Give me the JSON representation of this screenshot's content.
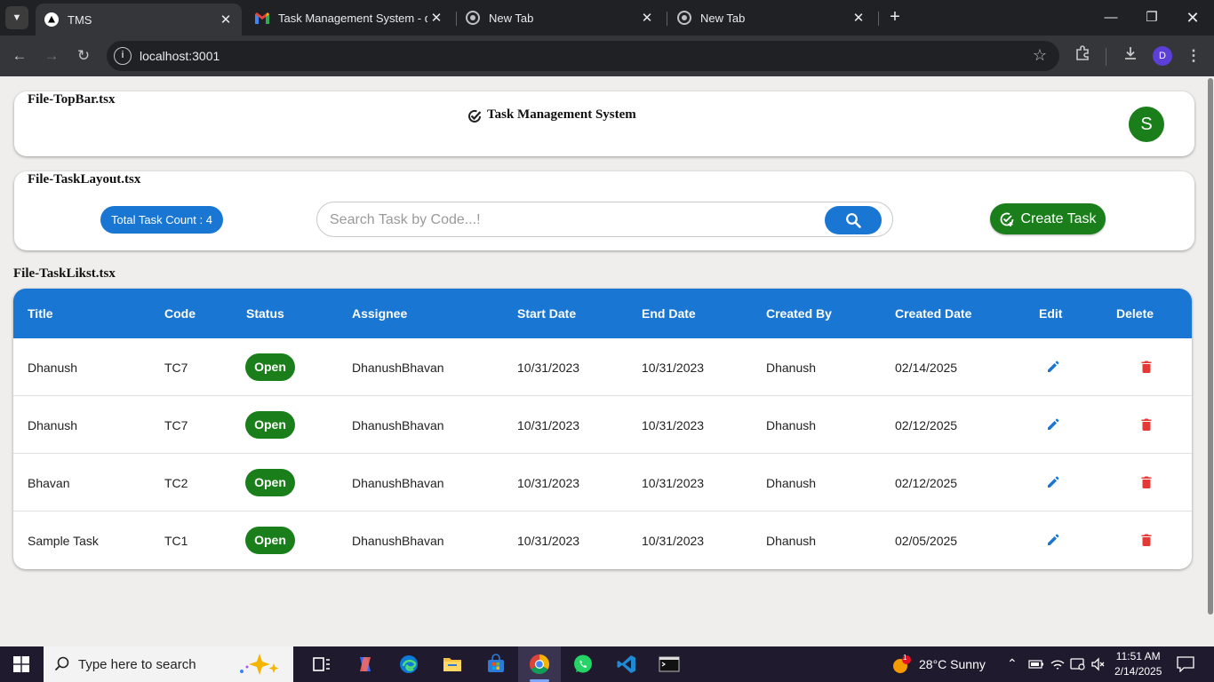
{
  "browser": {
    "tabs": [
      {
        "title": "TMS",
        "active": true
      },
      {
        "title": "Task Management System - dha",
        "active": false
      },
      {
        "title": "New Tab",
        "active": false
      },
      {
        "title": "New Tab",
        "active": false
      }
    ],
    "url": "localhost:3001",
    "profile_initial": "D"
  },
  "topbar": {
    "file_label": "File-TopBar.tsx",
    "title": "Task Management System",
    "avatar_initial": "S"
  },
  "task_layout": {
    "file_label": "File-TaskLayout.tsx",
    "count_label": "Total Task Count : 4",
    "search_placeholder": "Search Task by Code...!",
    "create_label": "Create Task"
  },
  "task_list": {
    "file_label": "File-TaskLikst.tsx",
    "columns": [
      "Title",
      "Code",
      "Status",
      "Assignee",
      "Start Date",
      "End Date",
      "Created By",
      "Created Date",
      "Edit",
      "Delete"
    ],
    "rows": [
      {
        "title": "Dhanush",
        "code": "TC7",
        "status": "Open",
        "assignee": "DhanushBhavan",
        "start": "10/31/2023",
        "end": "10/31/2023",
        "created_by": "Dhanush",
        "created_date": "02/14/2025"
      },
      {
        "title": "Dhanush",
        "code": "TC7",
        "status": "Open",
        "assignee": "DhanushBhavan",
        "start": "10/31/2023",
        "end": "10/31/2023",
        "created_by": "Dhanush",
        "created_date": "02/12/2025"
      },
      {
        "title": "Bhavan",
        "code": "TC2",
        "status": "Open",
        "assignee": "DhanushBhavan",
        "start": "10/31/2023",
        "end": "10/31/2023",
        "created_by": "Dhanush",
        "created_date": "02/12/2025"
      },
      {
        "title": "Sample Task",
        "code": "TC1",
        "status": "Open",
        "assignee": "DhanushBhavan",
        "start": "10/31/2023",
        "end": "10/31/2023",
        "created_by": "Dhanush",
        "created_date": "02/05/2025"
      }
    ]
  },
  "colors": {
    "primary": "#1976d2",
    "success": "#1a7f1a",
    "danger": "#e53935"
  },
  "taskbar": {
    "search_text": "Type here to search",
    "weather": "28°C  Sunny",
    "weather_badge": "1",
    "time": "11:51 AM",
    "date": "2/14/2025"
  }
}
